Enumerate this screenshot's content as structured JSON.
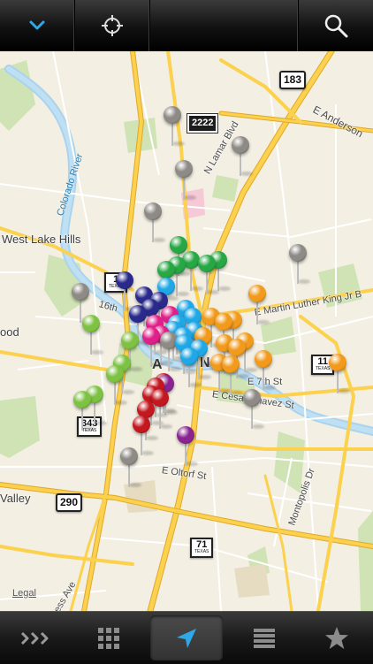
{
  "toolbar": {
    "items": [
      {
        "name": "collapse-chevron",
        "icon": "chevron-down-icon"
      },
      {
        "name": "locate-target",
        "icon": "crosshair-icon"
      },
      {
        "name": "search",
        "icon": "search-icon"
      }
    ],
    "accent_color": "#2fa8e8"
  },
  "map": {
    "place_labels": [
      "West Lake Hills",
      "ood",
      "Valley",
      "A",
      "N"
    ],
    "street_labels": [
      "N Lamar Blvd",
      "E Anderson",
      "E Martin Luther King Jr B",
      "E 7th St",
      "E Cesar Chavez St",
      "E Oltorf St",
      "Montopolis Dr",
      "ess Ave",
      "16th"
    ],
    "river_label": "Colorado River",
    "highway_shields": [
      "183",
      "2222",
      "1",
      "11",
      "343",
      "290",
      "71"
    ],
    "shield_sublabel": "TEXAS",
    "legal_link": "Legal",
    "pin_colors": {
      "gray": "#8e8a85",
      "green": "#28a745",
      "lime": "#7dc242",
      "cyan": "#20a8e6",
      "navy": "#2a2a8c",
      "magenta": "#e0208a",
      "orange": "#f29a1c",
      "red": "#c41820",
      "purple": "#8a2590"
    }
  },
  "tabbar": {
    "tabs": [
      {
        "name": "tab-more",
        "icon": "triple-chevron-right-icon",
        "active": false
      },
      {
        "name": "tab-grid",
        "icon": "grid-icon",
        "active": false
      },
      {
        "name": "tab-map",
        "icon": "navigation-arrow-icon",
        "active": true
      },
      {
        "name": "tab-list",
        "icon": "list-icon",
        "active": false
      },
      {
        "name": "tab-favorites",
        "icon": "star-icon",
        "active": false
      }
    ]
  }
}
